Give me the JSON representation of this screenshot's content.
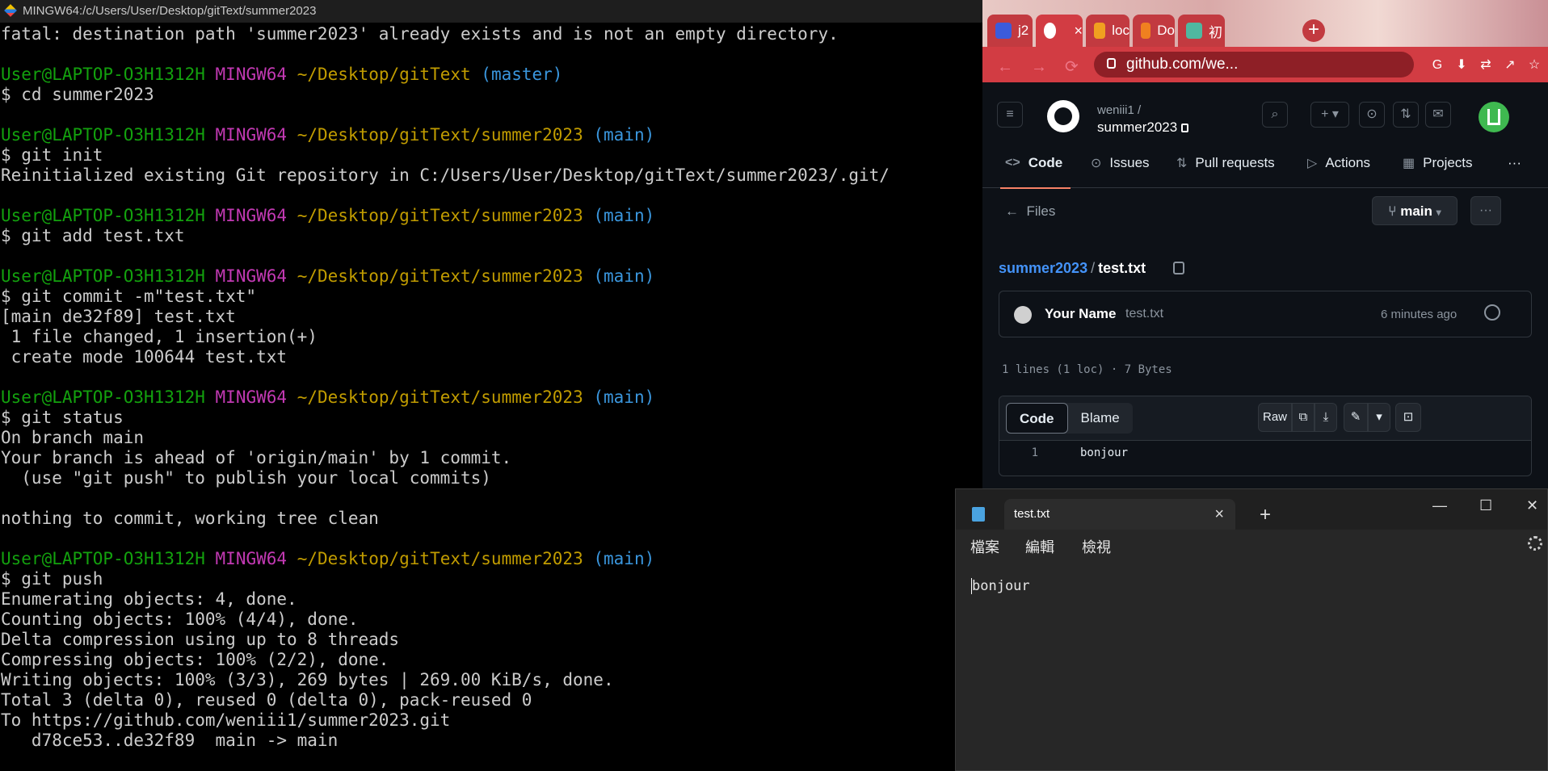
{
  "terminal": {
    "title": "MINGW64:/c/Users/User/Desktop/gitText/summer2023",
    "lines": [
      {
        "text": "fatal: destination path 'summer2023' already exists and is not an empty directory."
      },
      {
        "text": ""
      },
      {
        "prompt": {
          "user": "User@LAPTOP-O3H1312H",
          "shell": "MINGW64",
          "path": "~/Desktop/gitText",
          "branch": "(master)"
        }
      },
      {
        "text": "$ cd summer2023"
      },
      {
        "text": ""
      },
      {
        "prompt": {
          "user": "User@LAPTOP-O3H1312H",
          "shell": "MINGW64",
          "path": "~/Desktop/gitText/summer2023",
          "branch": "(main)"
        }
      },
      {
        "text": "$ git init"
      },
      {
        "text": "Reinitialized existing Git repository in C:/Users/User/Desktop/gitText/summer2023/.git/"
      },
      {
        "text": ""
      },
      {
        "prompt": {
          "user": "User@LAPTOP-O3H1312H",
          "shell": "MINGW64",
          "path": "~/Desktop/gitText/summer2023",
          "branch": "(main)"
        }
      },
      {
        "text": "$ git add test.txt"
      },
      {
        "text": ""
      },
      {
        "prompt": {
          "user": "User@LAPTOP-O3H1312H",
          "shell": "MINGW64",
          "path": "~/Desktop/gitText/summer2023",
          "branch": "(main)"
        }
      },
      {
        "text": "$ git commit -m\"test.txt\""
      },
      {
        "text": "[main de32f89] test.txt"
      },
      {
        "text": " 1 file changed, 1 insertion(+)"
      },
      {
        "text": " create mode 100644 test.txt"
      },
      {
        "text": ""
      },
      {
        "prompt": {
          "user": "User@LAPTOP-O3H1312H",
          "shell": "MINGW64",
          "path": "~/Desktop/gitText/summer2023",
          "branch": "(main)"
        }
      },
      {
        "text": "$ git status"
      },
      {
        "text": "On branch main"
      },
      {
        "text": "Your branch is ahead of 'origin/main' by 1 commit."
      },
      {
        "text": "  (use \"git push\" to publish your local commits)"
      },
      {
        "text": ""
      },
      {
        "text": "nothing to commit, working tree clean"
      },
      {
        "text": ""
      },
      {
        "prompt": {
          "user": "User@LAPTOP-O3H1312H",
          "shell": "MINGW64",
          "path": "~/Desktop/gitText/summer2023",
          "branch": "(main)"
        }
      },
      {
        "text": "$ git push"
      },
      {
        "text": "Enumerating objects: 4, done."
      },
      {
        "text": "Counting objects: 100% (4/4), done."
      },
      {
        "text": "Delta compression using up to 8 threads"
      },
      {
        "text": "Compressing objects: 100% (2/2), done."
      },
      {
        "text": "Writing objects: 100% (3/3), 269 bytes | 269.00 KiB/s, done."
      },
      {
        "text": "Total 3 (delta 0), reused 0 (delta 0), pack-reused 0"
      },
      {
        "text": "To https://github.com/weniii1/summer2023.git"
      },
      {
        "text": "   d78ce53..de32f89  main -> main"
      }
    ]
  },
  "browser": {
    "tabs": [
      {
        "label": "j2",
        "color": "#3b5bdb"
      },
      {
        "label": "",
        "color": "#ffffff"
      },
      {
        "label": "loc",
        "color": "#f0a020"
      },
      {
        "label": "Do",
        "color": "#f08020"
      },
      {
        "label": "初",
        "color": "#4fb8a0"
      }
    ],
    "tab_close": "×",
    "new_tab": "+",
    "url": "github.com/we..."
  },
  "github": {
    "owner": "weniii1 /",
    "repo": "summer2023",
    "nav_tabs": [
      "Code",
      "Issues",
      "Pull requests",
      "Actions",
      "Projects"
    ],
    "more": "···",
    "files_back": "Files",
    "branch": "main",
    "breadcrumb_repo": "summer2023",
    "breadcrumb_sep": "/",
    "breadcrumb_file": "test.txt",
    "commit_author": "Your Name",
    "commit_message": "test.txt",
    "commit_time": "6 minutes ago",
    "file_meta": "1 lines (1 loc) · 7 Bytes",
    "view_code": "Code",
    "view_blame": "Blame",
    "raw": "Raw",
    "line_number": "1",
    "line_content": "bonjour"
  },
  "notepad": {
    "tab_title": "test.txt",
    "tab_close": "×",
    "add_tab": "+",
    "menus": [
      "檔案",
      "編輯",
      "檢視"
    ],
    "content": "bonjour",
    "minimize": "—",
    "maximize": "☐",
    "close": "✕"
  }
}
